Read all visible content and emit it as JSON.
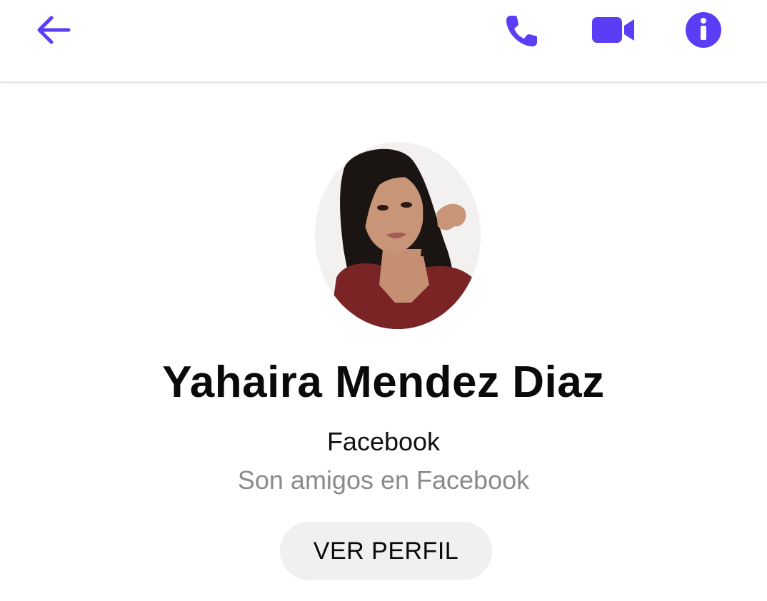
{
  "header": {
    "icons": {
      "back": "arrow-left-icon",
      "call": "phone-icon",
      "video": "video-camera-icon",
      "info": "info-icon"
    },
    "accent_color": "#5b3df5"
  },
  "profile": {
    "name": "Yahaira Mendez Diaz",
    "source": "Facebook",
    "relation": "Son amigos en Facebook",
    "view_profile_label": "VER PERFIL"
  }
}
